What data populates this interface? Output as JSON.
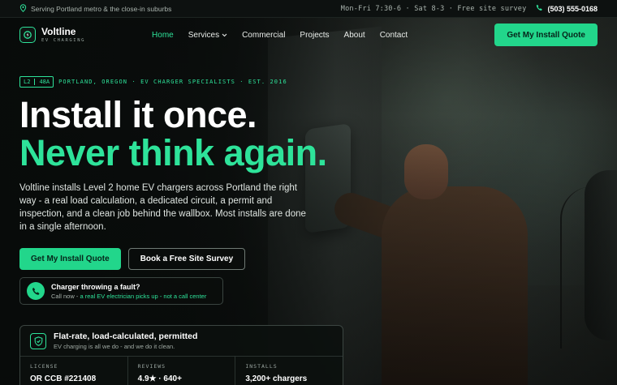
{
  "topbar": {
    "service_area": "Serving Portland metro & the close-in suburbs",
    "hours": "Mon-Fri 7:30-6 · Sat 8-3 · Free site survey",
    "phone": "(503) 555-0168"
  },
  "brand": {
    "name": "Voltline",
    "sub": "EV CHARGING"
  },
  "nav": {
    "items": [
      {
        "label": "Home"
      },
      {
        "label": "Services"
      },
      {
        "label": "Commercial"
      },
      {
        "label": "Projects"
      },
      {
        "label": "About"
      },
      {
        "label": "Contact"
      }
    ],
    "cta": "Get My Install Quote"
  },
  "hero": {
    "chip_a": "L2",
    "chip_b": "48A",
    "tagline": "PORTLAND, OREGON · EV CHARGER SPECIALISTS · EST. 2016",
    "headline_1": "Install it once.",
    "headline_2": "Never think again.",
    "lead": "Voltline installs Level 2 home EV chargers across Portland the right way - a real load calculation, a dedicated circuit, a permit and inspection, and a clean job behind the wallbox. Most installs are done in a single afternoon.",
    "primary_cta": "Get My Install Quote",
    "secondary_cta": "Book a Free Site Survey",
    "fault_title": "Charger throwing a fault?",
    "fault_lead": "Call now - ",
    "fault_highlight": "a real EV electrician picks up - not a call center"
  },
  "card": {
    "title": "Flat-rate, load-calculated, permitted",
    "subtitle": "EV charging is all we do - and we do it clean.",
    "stats": [
      {
        "label": "LICENSE",
        "value": "OR CCB #221408"
      },
      {
        "label": "REVIEWS",
        "value": "4.9★ · 640+"
      },
      {
        "label": "INSTALLS",
        "value": "3,200+ chargers"
      }
    ]
  },
  "colors": {
    "accent": "#2ee39a",
    "button": "#22d68b",
    "background": "#0b0f0d"
  },
  "icons": [
    "map-pin-icon",
    "phone-icon",
    "plug-icon",
    "chevron-down-icon",
    "phone-circle-icon",
    "shield-icon"
  ]
}
